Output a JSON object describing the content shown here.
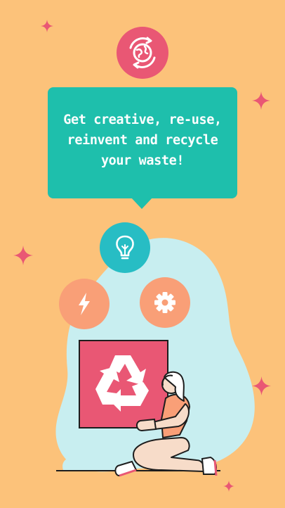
{
  "message": {
    "line1": "Get creative, re-use,",
    "line2": "reinvent and recycle",
    "line3": "your waste!"
  },
  "colors": {
    "background": "#fcc27a",
    "bubble": "#1ebfac",
    "pink": "#e95774",
    "blob": "#c8eef0",
    "peach": "#f99f77",
    "teal_circle": "#27bdc4"
  },
  "icons": {
    "top": "earth-recycle-icon",
    "bulb": "lightbulb-icon",
    "bolt": "lightning-bolt-icon",
    "gear": "gear-icon",
    "box": "recycle-icon",
    "sparkle": "sparkle-icon"
  }
}
